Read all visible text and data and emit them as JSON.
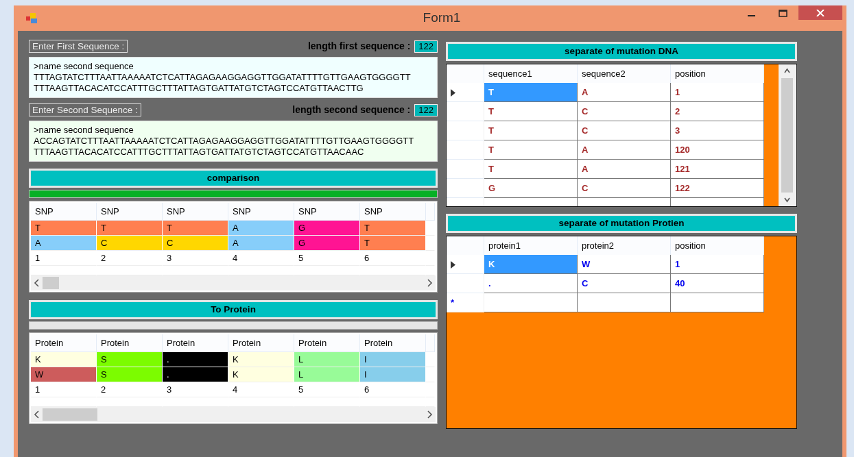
{
  "window": {
    "title": "Form1"
  },
  "first_sequence": {
    "label": "Enter First Sequence :",
    "length_label": "length first sequence :",
    "length": "122",
    "lines": [
      ">name second sequence",
      "TTTAGTATCTTTAATTAAAAATCTCATTAGAGAAGGAGGTTGGATATTTTGTTGAAGTGGGGTT",
      "TTTAAGTTACACATCCATTTGCTTTATTAGTGATTATGTCTAGTCCATGTTAACTTG"
    ]
  },
  "second_sequence": {
    "label": "Enter Second Sequence :",
    "length_label": "length second sequence :",
    "length": "122",
    "lines": [
      ">name second sequence",
      "ACCAGTATCTTTAATTAAAAATCTCATTAGAGAAGGAGGTTGGATATTTTGTTGAAGTGGGGTT",
      "TTTAAGTTACACATCCATTTGCTTTATTAGTGATTATGTCTAGTCCATGTTAACAAC"
    ]
  },
  "comparison": {
    "title": "comparison",
    "progress": {
      "level": 1
    },
    "columns": [
      "SNP",
      "SNP",
      "SNP",
      "SNP",
      "SNP",
      "SNP"
    ],
    "rows": [
      {
        "cells": [
          {
            "text": "T",
            "color": "#ff7f50"
          },
          {
            "text": "T",
            "color": "#ff7f50"
          },
          {
            "text": "T",
            "color": "#ff7f50"
          },
          {
            "text": "A",
            "color": "#87cefa"
          },
          {
            "text": "G",
            "color": "#ff1493"
          },
          {
            "text": "T",
            "color": "#ff7f50"
          }
        ]
      },
      {
        "cells": [
          {
            "text": "A",
            "color": "#87cefa"
          },
          {
            "text": "C",
            "color": "#ffd700"
          },
          {
            "text": "C",
            "color": "#ffd700"
          },
          {
            "text": "A",
            "color": "#87cefa"
          },
          {
            "text": "G",
            "color": "#ff1493"
          },
          {
            "text": "T",
            "color": "#ff7f50"
          }
        ]
      },
      {
        "cells": [
          {
            "text": "1"
          },
          {
            "text": "2"
          },
          {
            "text": "3"
          },
          {
            "text": "4"
          },
          {
            "text": "5"
          },
          {
            "text": "6"
          }
        ]
      }
    ]
  },
  "to_protein": {
    "title": "To Protein",
    "progress": {
      "level": 0
    },
    "columns": [
      "Protein",
      "Protein",
      "Protein",
      "Protein",
      "Protein",
      "Protein"
    ],
    "rows": [
      {
        "cells": [
          {
            "text": "K",
            "color": "#ffffe0"
          },
          {
            "text": "S",
            "color": "#7cfc00"
          },
          {
            "text": ".",
            "color": "#000000"
          },
          {
            "text": "K",
            "color": "#ffffe0"
          },
          {
            "text": "L",
            "color": "#98fb98"
          },
          {
            "text": "I",
            "color": "#87ceeb"
          }
        ]
      },
      {
        "cells": [
          {
            "text": "W",
            "color": "#cd5c5c"
          },
          {
            "text": "S",
            "color": "#7cfc00"
          },
          {
            "text": ".",
            "color": "#000000"
          },
          {
            "text": "K",
            "color": "#ffffe0"
          },
          {
            "text": "L",
            "color": "#98fb98"
          },
          {
            "text": "I",
            "color": "#87ceeb"
          }
        ]
      },
      {
        "cells": [
          {
            "text": "1"
          },
          {
            "text": "2"
          },
          {
            "text": "3"
          },
          {
            "text": "4"
          },
          {
            "text": "5"
          },
          {
            "text": "6"
          }
        ]
      }
    ]
  },
  "dna_mutations": {
    "title": "separate of mutation DNA",
    "columns": [
      "sequence1",
      "sequence2",
      "position"
    ],
    "rows": [
      {
        "selected": true,
        "cells": [
          "T",
          "A",
          "1"
        ]
      },
      {
        "selected": false,
        "cells": [
          "T",
          "C",
          "2"
        ]
      },
      {
        "selected": false,
        "cells": [
          "T",
          "C",
          "3"
        ]
      },
      {
        "selected": false,
        "cells": [
          "T",
          "A",
          "120"
        ]
      },
      {
        "selected": false,
        "cells": [
          "T",
          "A",
          "121"
        ]
      },
      {
        "selected": false,
        "cells": [
          "G",
          "C",
          "122"
        ]
      }
    ]
  },
  "protein_mutations": {
    "title": "separate of mutation Protien",
    "columns": [
      "protein1",
      "protein2",
      "position"
    ],
    "new_row_marker": "*",
    "rows": [
      {
        "selected": true,
        "cells": [
          "K",
          "W",
          "1"
        ]
      },
      {
        "selected": false,
        "cells": [
          ".",
          "C",
          "40"
        ]
      }
    ]
  }
}
